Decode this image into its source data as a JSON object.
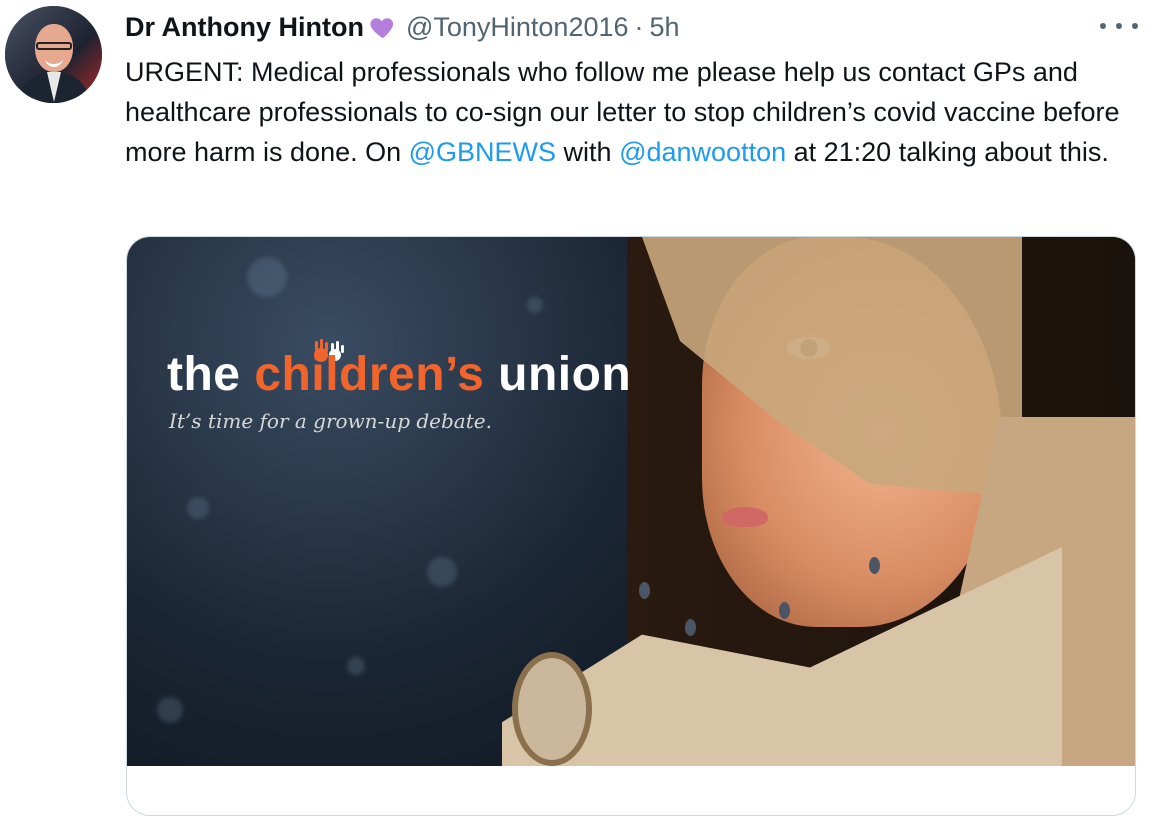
{
  "tweet": {
    "author_name": "Dr Anthony Hinton",
    "author_emoji": "purple-heart-icon",
    "handle": "@TonyHinton2016",
    "separator": "·",
    "time": "5h",
    "text_segments": {
      "part1": "URGENT: Medical professionals who follow me please help us contact GPs and healthcare professionals to co-sign our letter to stop children’s covid vaccine before more harm is done. On ",
      "mention1": "@GBNEWS",
      "part2": " with ",
      "mention2": "@danwootton",
      "part3": " at 21:20 talking about this."
    }
  },
  "card": {
    "logo_prefix": "the ",
    "logo_accent": "children’s",
    "logo_suffix": " union",
    "tagline": "It’s time for a grown-up debate."
  },
  "colors": {
    "link": "#1d9bf0",
    "secondary_text": "#536471",
    "logo_accent": "#f1652d",
    "heart": "#b57edc"
  }
}
